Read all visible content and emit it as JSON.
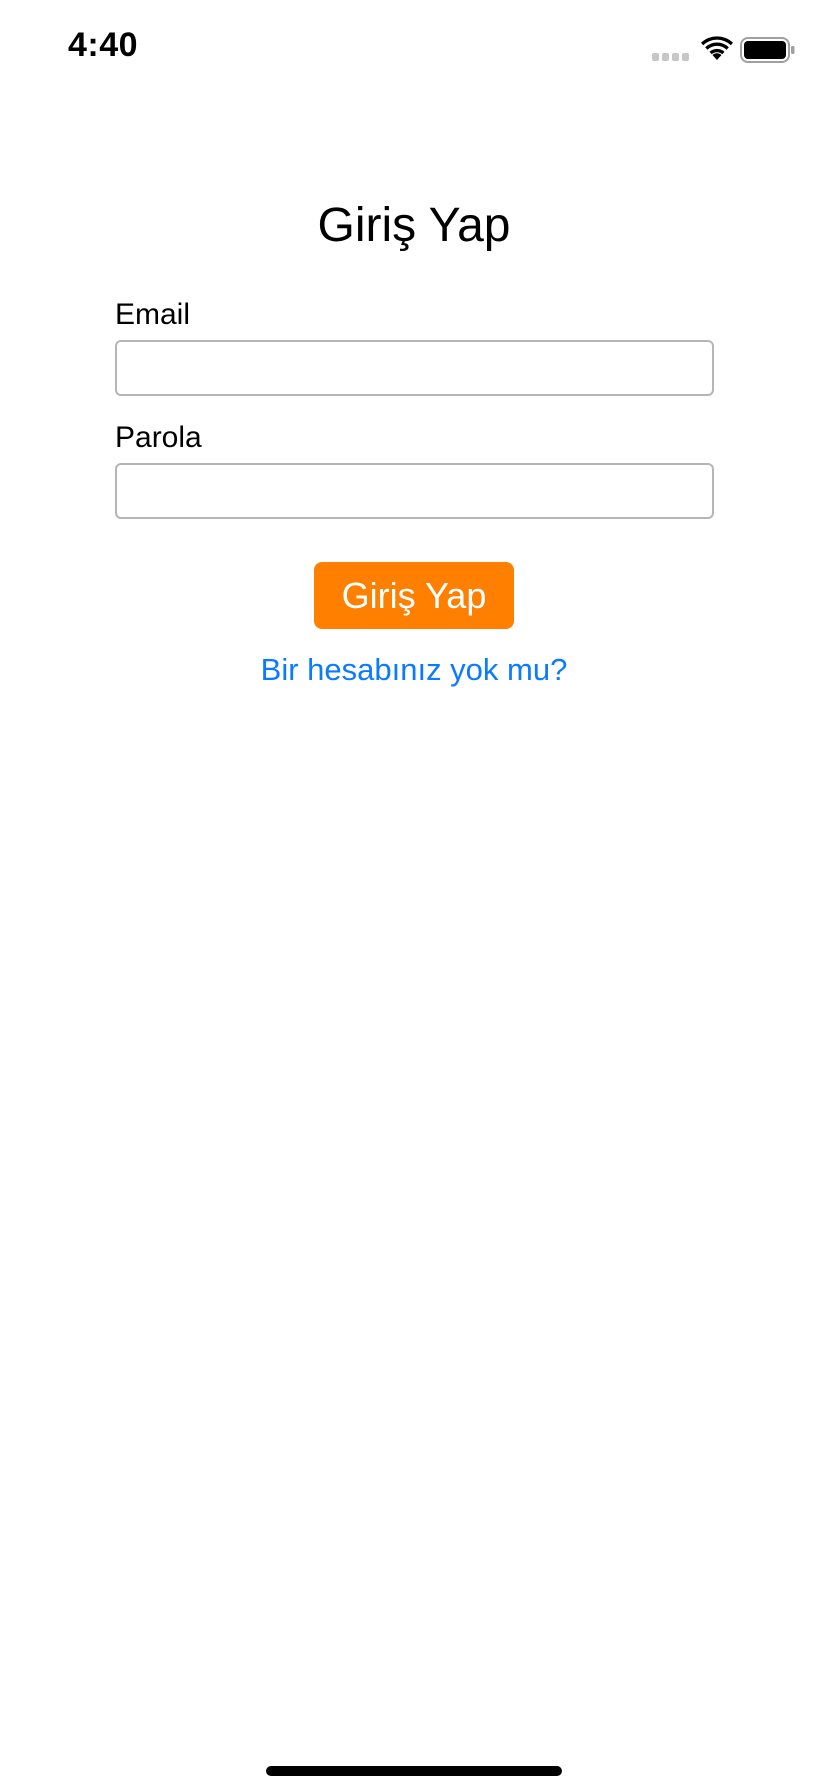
{
  "status_bar": {
    "time": "4:40",
    "icons": [
      "cellular-signal-icon",
      "wifi-icon",
      "battery-icon"
    ]
  },
  "login": {
    "title": "Giriş Yap",
    "email_label": "Email",
    "email_value": "",
    "password_label": "Parola",
    "password_value": "",
    "submit_label": "Giriş Yap",
    "signup_link": "Bir hesabınız yok mu?"
  },
  "colors": {
    "accent": "#ff8000",
    "link": "#0a7aff",
    "field_border": "#b5b5b5",
    "background": "#ffffff"
  }
}
